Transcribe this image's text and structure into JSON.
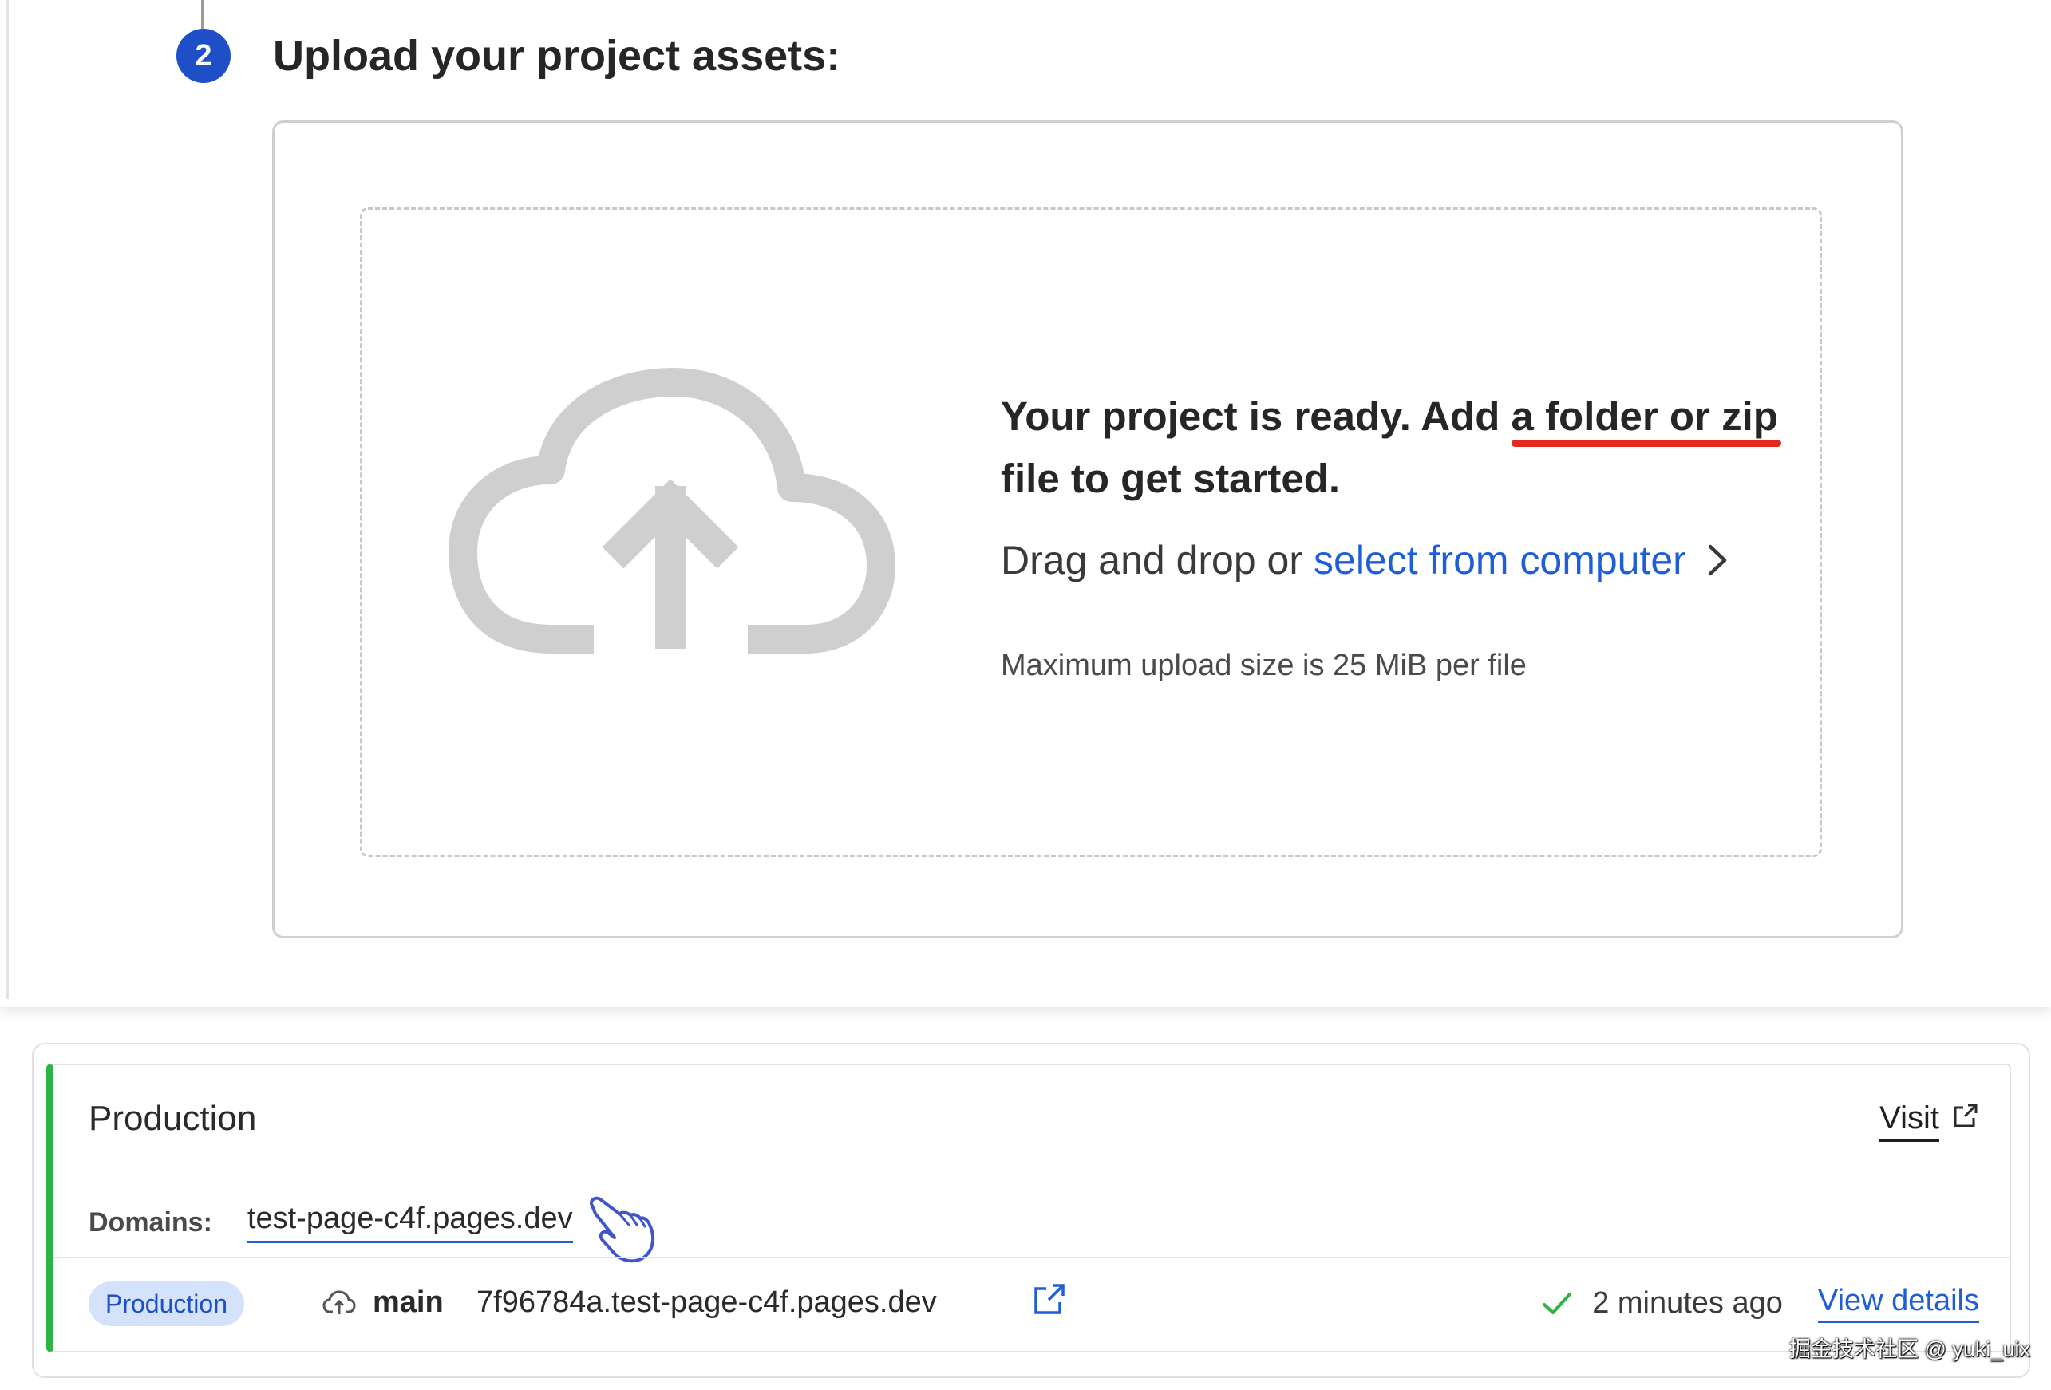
{
  "step": {
    "number": "2",
    "title": "Upload your project assets:"
  },
  "upload": {
    "ready_text_start": "Your project is ready. Add ",
    "ready_text_highlight": "a folder or zip",
    "ready_text_end": " file to get started.",
    "drag_text": "Drag and drop or",
    "select_link": "select from computer",
    "max_size_text": "Maximum upload size is 25 MiB per file",
    "icon": "cloud-upload-icon"
  },
  "production": {
    "title": "Production",
    "visit_label": "Visit",
    "domains_label": "Domains:",
    "domain": "test-page-c4f.pages.dev",
    "badge": "Production",
    "branch": "main",
    "deploy_url": "7f96784a.test-page-c4f.pages.dev",
    "time_ago": "2 minutes ago",
    "view_details": "View details"
  },
  "watermark": "掘金技术社区 @ yuki_uix",
  "colors": {
    "accent_blue": "#1e5ed6",
    "step_badge": "#1e4fc6",
    "status_green": "#2fb344",
    "highlight_red": "#e3291d",
    "badge_bg": "#d4e3fb"
  }
}
